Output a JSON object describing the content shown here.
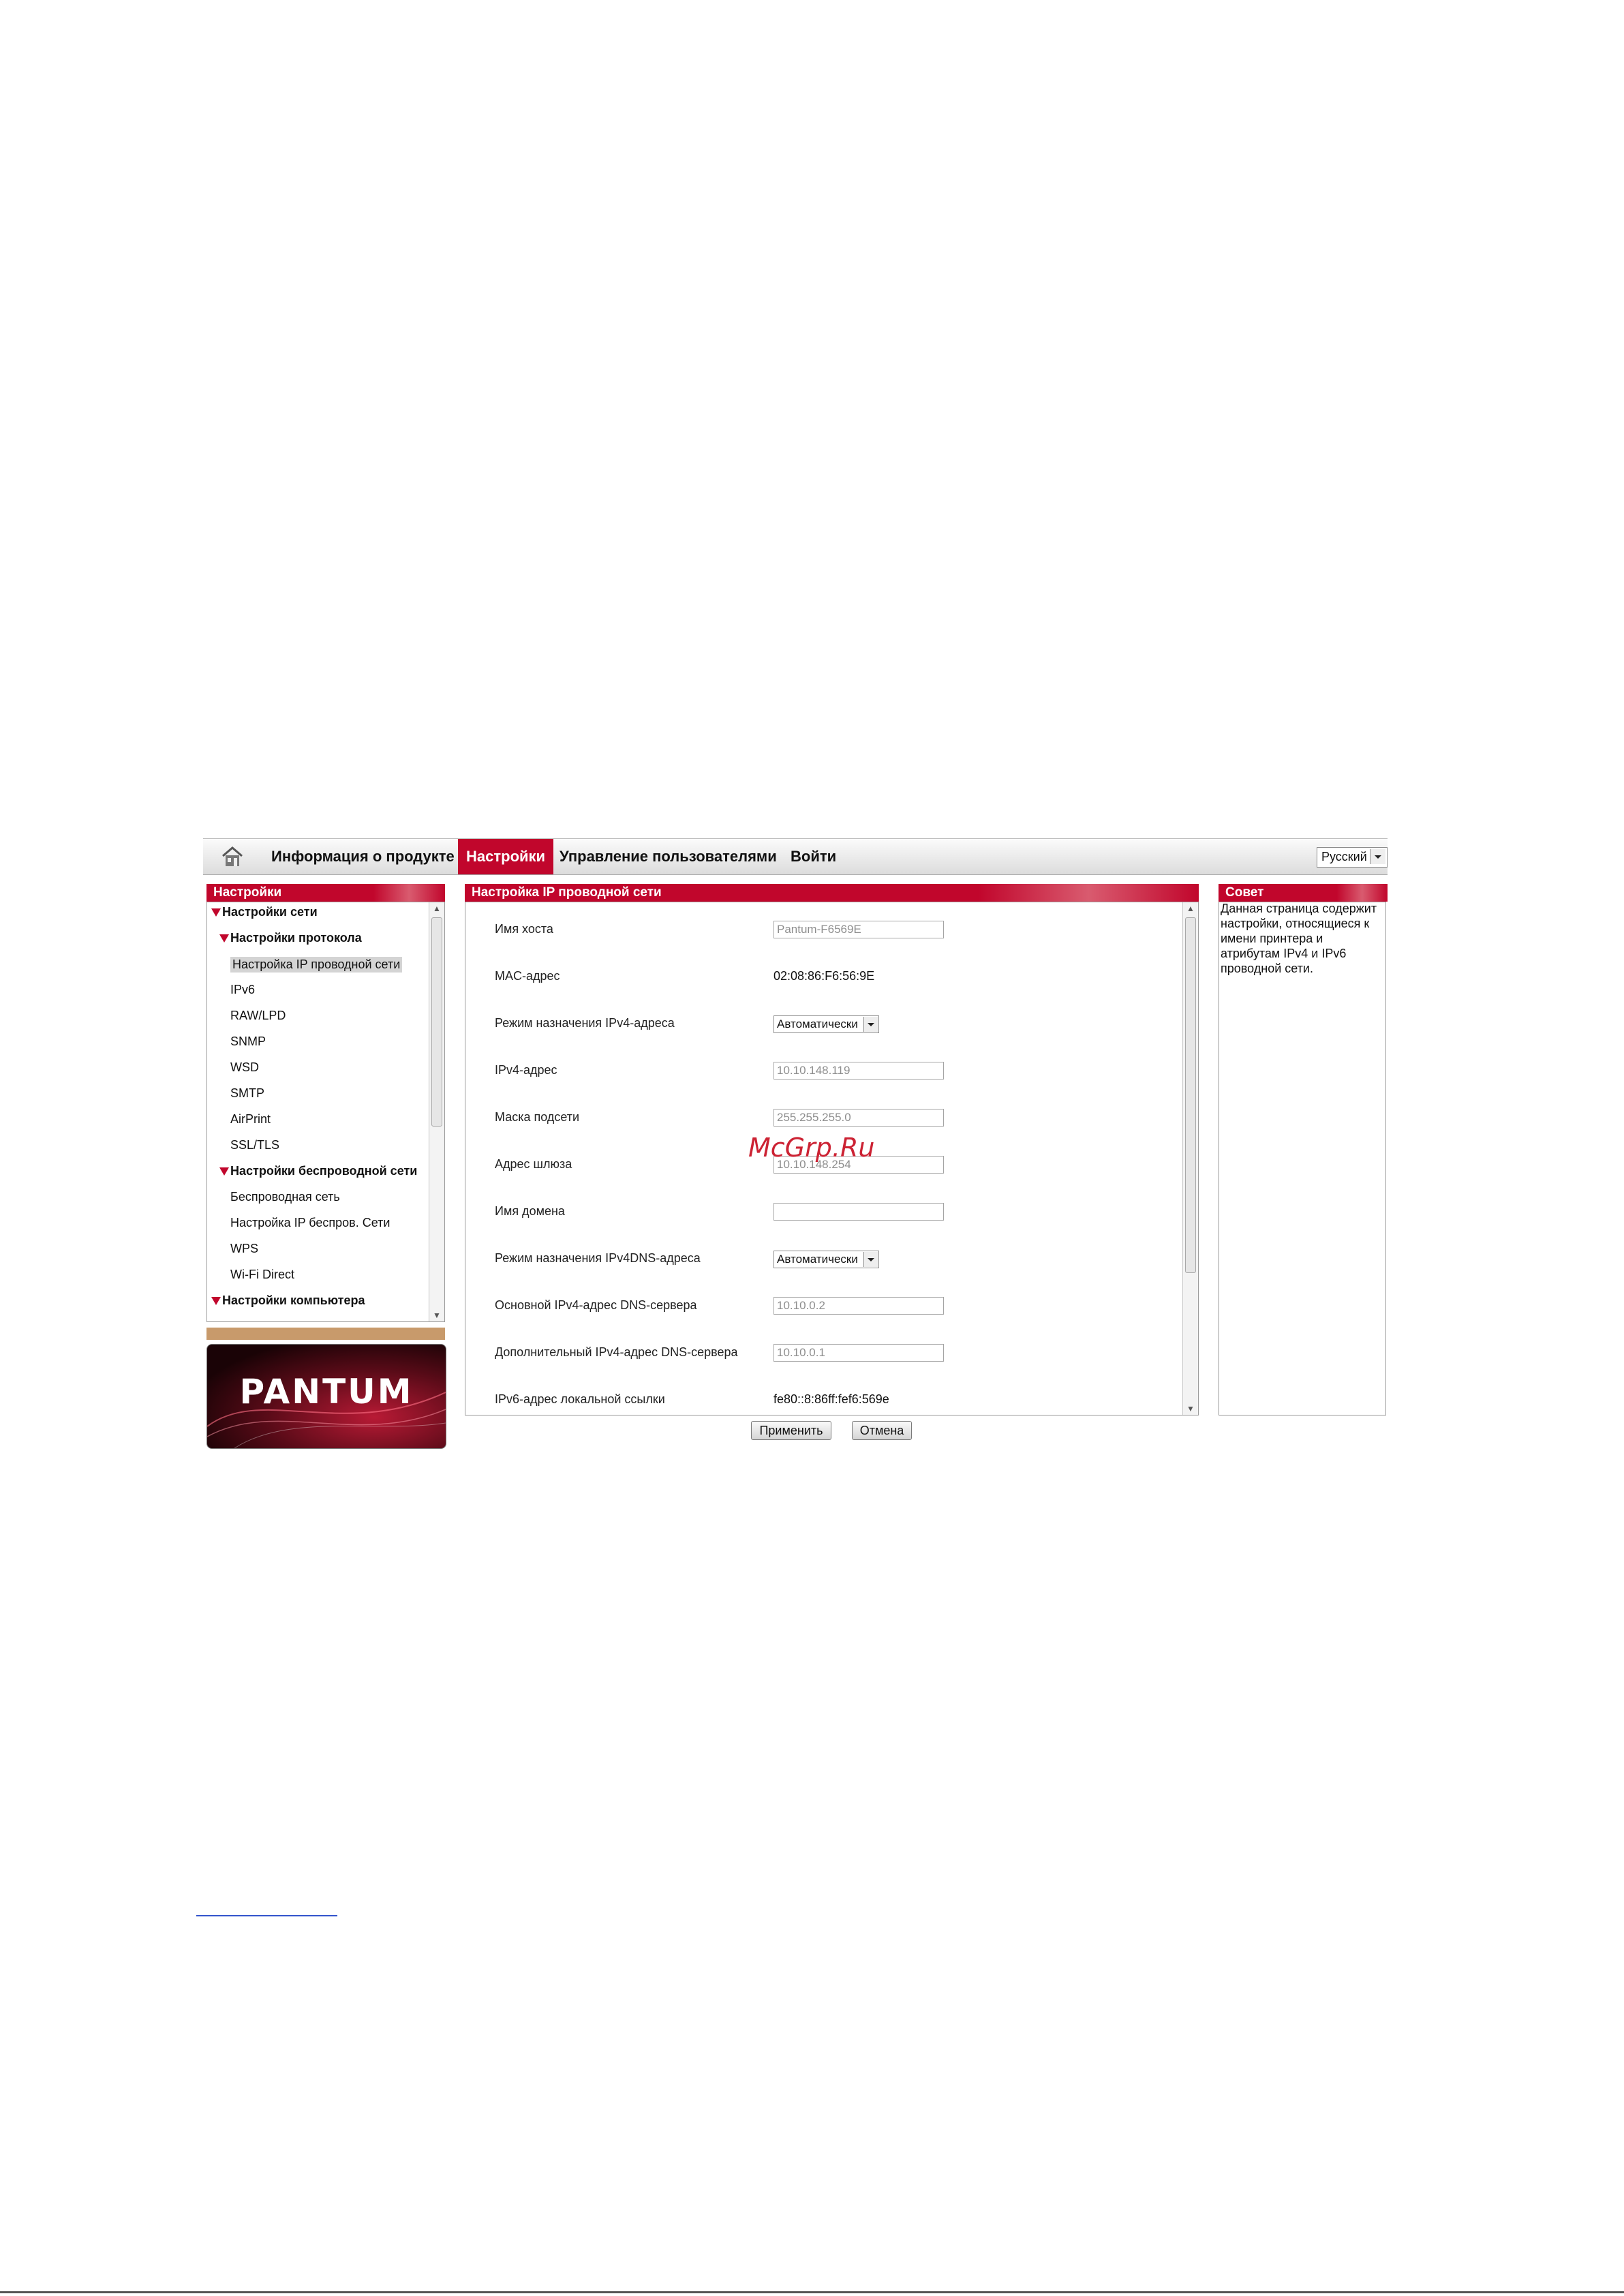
{
  "nav": {
    "items": [
      "Информация о продукте",
      "Настройки",
      "Управление пользователями",
      "Войти"
    ],
    "active": "Настройки",
    "language": "Русский"
  },
  "sidebar": {
    "title": "Настройки",
    "tree": [
      {
        "label": "Настройки сети",
        "level": 0,
        "expanded": true
      },
      {
        "label": "Настройки протокола",
        "level": 1,
        "expanded": true
      },
      {
        "label": "Настройка IP проводной сети",
        "level": 2,
        "selected": true
      },
      {
        "label": "IPv6",
        "level": 2
      },
      {
        "label": "RAW/LPD",
        "level": 2
      },
      {
        "label": "SNMP",
        "level": 2
      },
      {
        "label": "WSD",
        "level": 2
      },
      {
        "label": "SMTP",
        "level": 2
      },
      {
        "label": "AirPrint",
        "level": 2
      },
      {
        "label": "SSL/TLS",
        "level": 2
      },
      {
        "label": "Настройки беспроводной сети",
        "level": 1,
        "expanded": true
      },
      {
        "label": "Беспроводная сеть",
        "level": 2
      },
      {
        "label": "Настройка IP беспров. Сети",
        "level": 2
      },
      {
        "label": "WPS",
        "level": 2
      },
      {
        "label": "Wi-Fi Direct",
        "level": 2
      },
      {
        "label": "Настройки компьютера",
        "level": 0,
        "expanded": true
      }
    ],
    "logo_text": "PANTUM"
  },
  "main": {
    "title": "Настройка IP проводной сети",
    "fields": [
      {
        "label": "Имя хоста",
        "type": "input",
        "value": "Pantum-F6569E"
      },
      {
        "label": "MAC-адрес",
        "type": "text",
        "value": "02:08:86:F6:56:9E"
      },
      {
        "label": "Режим назначения IPv4-адреса",
        "type": "select",
        "value": "Автоматически"
      },
      {
        "label": "IPv4-адрес",
        "type": "input",
        "value": "10.10.148.119"
      },
      {
        "label": "Маска подсети",
        "type": "input",
        "value": "255.255.255.0"
      },
      {
        "label": "Адрес шлюза",
        "type": "input",
        "value": "10.10.148.254"
      },
      {
        "label": "Имя домена",
        "type": "input",
        "value": ""
      },
      {
        "label": "Режим назначения IPv4DNS-адреса",
        "type": "select",
        "value": "Автоматически"
      },
      {
        "label": "Основной IPv4-адрес DNS-сервера",
        "type": "input",
        "value": "10.10.0.2"
      },
      {
        "label": "Дополнительный IPv4-адрес DNS-сервера",
        "type": "input",
        "value": "10.10.0.1"
      },
      {
        "label": "IPv6-адрес локальной ссылки",
        "type": "text",
        "value": "fe80::8:86ff:fef6:569e"
      }
    ],
    "apply_label": "Применить",
    "cancel_label": "Отмена"
  },
  "hint": {
    "title": "Совет",
    "text": "Данная страница содержит настройки, относящиеся к имени принтера и атрибутам IPv4 и IPv6 проводной сети."
  },
  "watermark": "McGrp.Ru",
  "colors": {
    "accent": "#c1062c",
    "logo_strip": "#c89a6b"
  }
}
